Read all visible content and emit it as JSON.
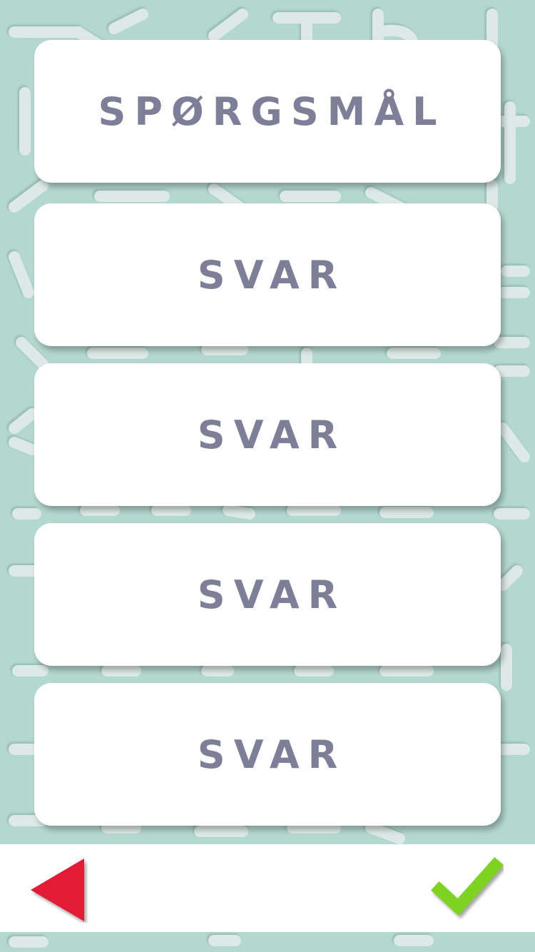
{
  "question": {
    "label": "SPØRGSMÅL"
  },
  "answers": [
    {
      "label": "SVAR"
    },
    {
      "label": "SVAR"
    },
    {
      "label": "SVAR"
    },
    {
      "label": "SVAR"
    }
  ],
  "navigation": {
    "back_icon": "triangle-left-icon",
    "confirm_icon": "checkmark-icon"
  },
  "colors": {
    "background": "#b3d8d0",
    "card": "#ffffff",
    "card_text": "#7d7f98",
    "back_arrow": "#e31b34",
    "checkmark": "#7ed321"
  }
}
